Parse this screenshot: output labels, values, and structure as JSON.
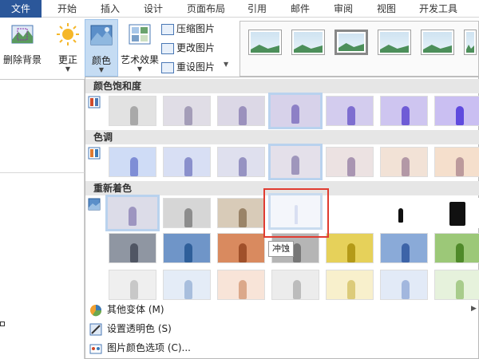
{
  "tabs": [
    "文件",
    "开始",
    "插入",
    "设计",
    "页面布局",
    "引用",
    "邮件",
    "审阅",
    "视图",
    "开发工具"
  ],
  "ribbon": {
    "remove_bg": "删除背景",
    "correct": "更正",
    "color": "颜色",
    "artistic": "艺术效果",
    "compress": "压缩图片",
    "change": "更改图片",
    "reset": "重设图片"
  },
  "sections": {
    "saturation": "颜色饱和度",
    "tone": "色调",
    "recolor": "重新着色"
  },
  "tooltip": "冲蚀",
  "menu": {
    "more_variants": "其他变体 (M)",
    "set_transparent": "设置透明色 (S)",
    "color_options": "图片颜色选项 (C)..."
  },
  "colors": {
    "accent": "#2b579a",
    "selection_red": "#e03c31",
    "highlight_blue": "#b9d2ee"
  },
  "icons": [
    "remove-background-icon",
    "sun-icon",
    "color-icon",
    "artistic-effects-icon",
    "compress-icon",
    "change-picture-icon",
    "reset-picture-icon",
    "saturation-icon",
    "tone-icon",
    "recolor-icon",
    "variants-icon",
    "transparent-icon",
    "color-options-icon"
  ]
}
